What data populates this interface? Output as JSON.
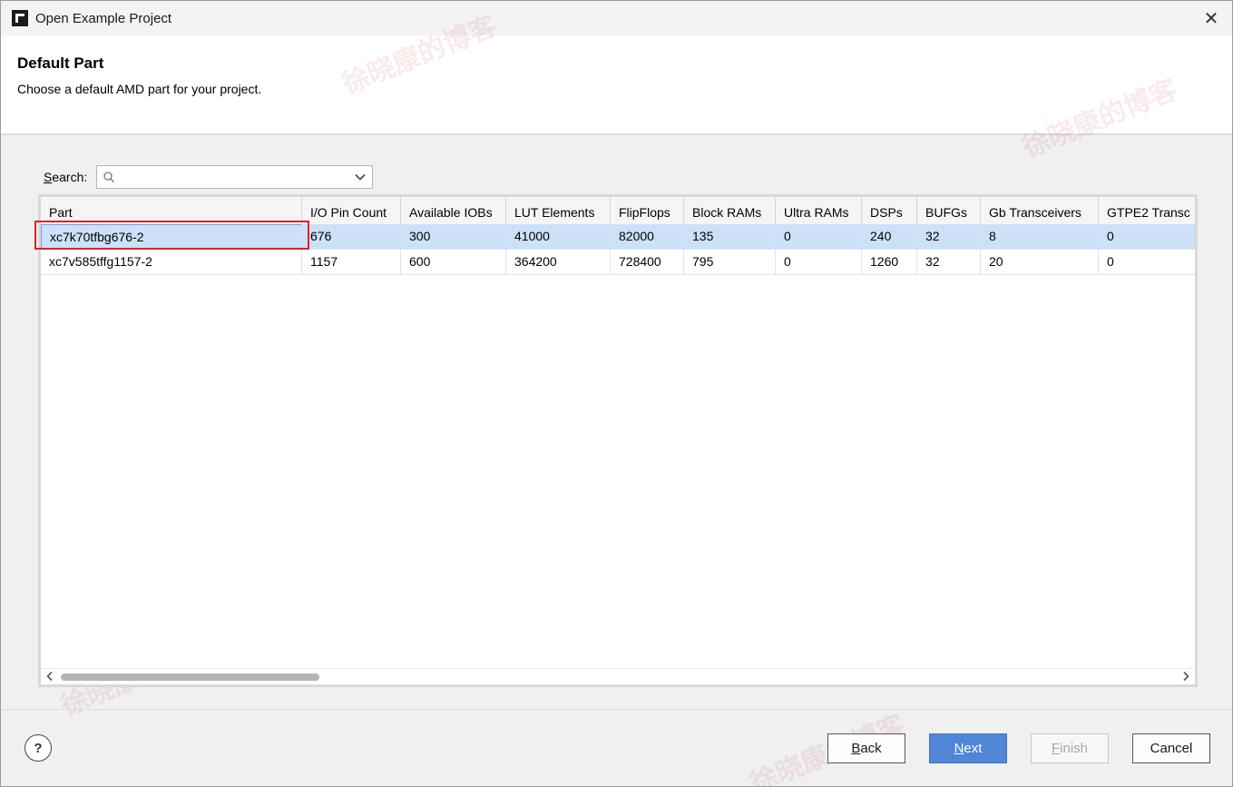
{
  "window": {
    "title": "Open Example Project",
    "close_glyph": "✕"
  },
  "header": {
    "title": "Default Part",
    "subtitle": "Choose a default AMD part for your project."
  },
  "search": {
    "label_underlined": "S",
    "label_rest": "earch:",
    "value": "",
    "placeholder": ""
  },
  "table": {
    "columns": [
      "Part",
      "I/O Pin Count",
      "Available IOBs",
      "LUT Elements",
      "FlipFlops",
      "Block RAMs",
      "Ultra RAMs",
      "DSPs",
      "BUFGs",
      "Gb Transceivers",
      "GTPE2 Transc"
    ],
    "rows": [
      [
        "xc7k70tfbg676-2",
        "676",
        "300",
        "41000",
        "82000",
        "135",
        "0",
        "240",
        "32",
        "8",
        "0"
      ],
      [
        "xc7v585tffg1157-2",
        "1157",
        "600",
        "364200",
        "728400",
        "795",
        "0",
        "1260",
        "32",
        "20",
        "0"
      ]
    ],
    "selected_row": 0
  },
  "buttons": {
    "help": "?",
    "back_underlined": "B",
    "back_rest": "ack",
    "next_underlined": "N",
    "next_rest": "ext",
    "finish_underlined": "F",
    "finish_rest": "inish",
    "cancel": "Cancel"
  },
  "watermark": "徐晓康的博客",
  "icons": {
    "app": "amd-logo-icon",
    "close": "close-icon",
    "search": "search-icon",
    "dropdown": "chevron-down-icon",
    "scroll_left": "chevron-left-icon",
    "scroll_right": "chevron-right-icon"
  },
  "colors": {
    "selected_row": "#cde0fa",
    "primary_button": "#4f86d6",
    "highlight_box": "#e0202a"
  }
}
